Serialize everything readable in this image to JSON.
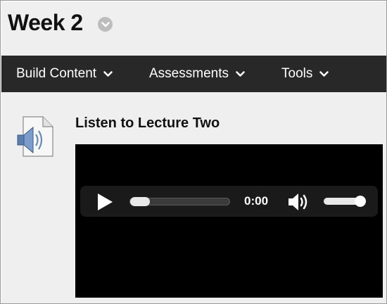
{
  "header": {
    "title": "Week 2",
    "menu_icon": "chevron-down-icon"
  },
  "navbar": {
    "items": [
      {
        "label": "Build Content",
        "icon": "chevron-down-icon"
      },
      {
        "label": "Assessments",
        "icon": "chevron-down-icon"
      },
      {
        "label": "Tools",
        "icon": "chevron-down-icon"
      }
    ]
  },
  "content_item": {
    "icon": "audio-file-icon",
    "title": "Listen to Lecture Two",
    "player": {
      "time": "0:00",
      "progress": 0,
      "volume": 1.0,
      "play_icon": "play-icon",
      "volume_icon": "volume-icon"
    }
  },
  "colors": {
    "navbar": "#282828",
    "header_bg": "#efefef",
    "player_bg": "#000000"
  }
}
